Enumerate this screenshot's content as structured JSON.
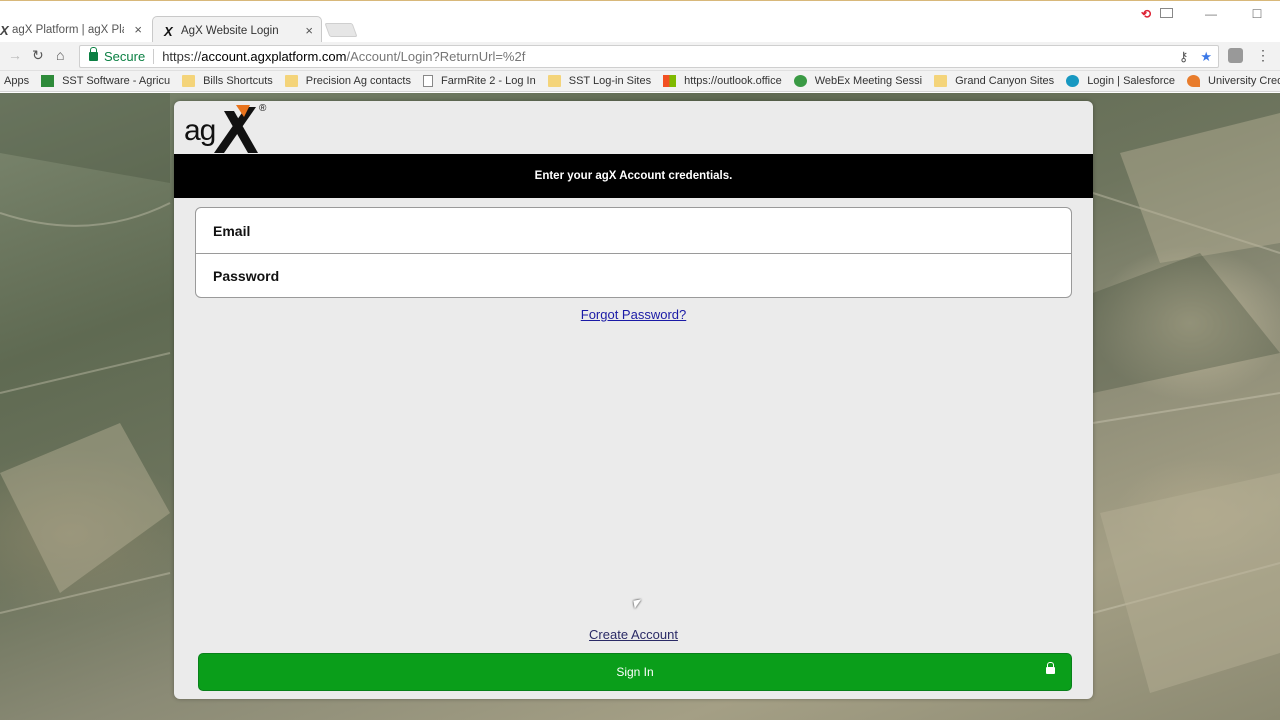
{
  "browser": {
    "tabs": [
      {
        "title": "agX Platform | agX Platfo",
        "icon": "agx-tab-icon",
        "active": false
      },
      {
        "title": "AgX Website Login",
        "icon": "agx-tab-icon",
        "active": true
      }
    ],
    "tab_close": "×",
    "window_controls": {
      "minimize": "—",
      "maximize": "☐"
    },
    "address": {
      "secure_label": "Secure",
      "url_scheme": "https://",
      "url_host": "account.agxplatform.com",
      "url_path": "/Account/Login?ReturnUrl=%2f"
    },
    "bookmarks": [
      {
        "label": "Apps",
        "icon": "apps-icon"
      },
      {
        "label": "SST Software - Agricu",
        "icon": "sst-icon"
      },
      {
        "label": "Bills Shortcuts",
        "icon": "folder-icon"
      },
      {
        "label": "Precision Ag contacts",
        "icon": "folder-icon"
      },
      {
        "label": "FarmRite 2 - Log In",
        "icon": "page-icon"
      },
      {
        "label": "SST Log-in Sites",
        "icon": "folder-icon"
      },
      {
        "label": "https://outlook.office",
        "icon": "microsoft-icon"
      },
      {
        "label": "WebEx Meeting Sessi",
        "icon": "webex-icon"
      },
      {
        "label": "Grand Canyon Sites",
        "icon": "folder-icon"
      },
      {
        "label": "Login | Salesforce",
        "icon": "salesforce-icon"
      },
      {
        "label": "University Credit Unic",
        "icon": "credit-union-icon"
      }
    ]
  },
  "login": {
    "logo_text": "agX",
    "logo_reg": "®",
    "banner": "Enter your agX Account credentials.",
    "email_placeholder": "Email",
    "password_placeholder": "Password",
    "forgot_password": "Forgot Password?",
    "create_account": "Create Account",
    "sign_in": "Sign In"
  },
  "colors": {
    "sign_in_green": "#0a9e1a",
    "banner_black": "#000000",
    "card_bg": "#ebebeb",
    "link_blue": "#1a1aa6",
    "secure_green": "#0b8043"
  }
}
